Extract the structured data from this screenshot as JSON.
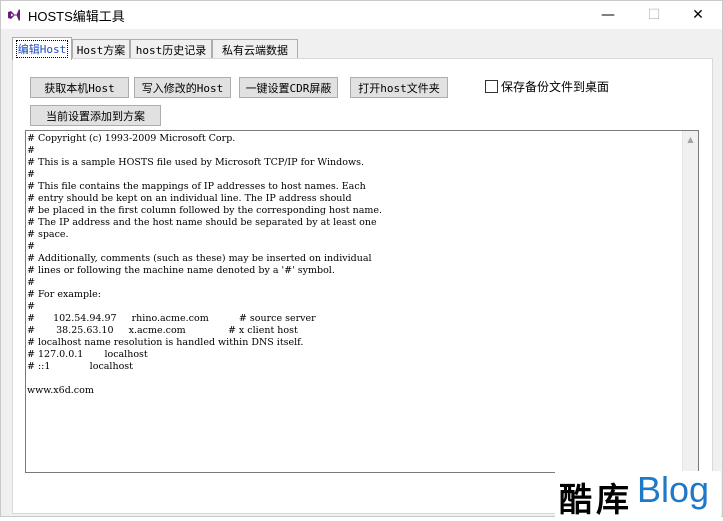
{
  "window": {
    "title": "HOSTS编辑工具",
    "minimize_glyph": "—",
    "maximize_glyph": "☐",
    "close_glyph": "✕"
  },
  "tabs": [
    {
      "label": "编辑Host",
      "active": true
    },
    {
      "label": "Host方案",
      "active": false
    },
    {
      "label": "host历史记录",
      "active": false
    },
    {
      "label": "私有云端数据",
      "active": false
    }
  ],
  "toolbar": {
    "get_local_host": "获取本机Host",
    "write_changes_host": "写入修改的Host",
    "one_click_cdr_block": "一键设置CDR屏蔽",
    "open_host_folder": "打开host文件夹",
    "add_current_to_plan": "当前设置添加到方案",
    "backup_checkbox_label": "保存备份文件到桌面",
    "backup_checked": false
  },
  "editor": {
    "content": "# Copyright (c) 1993-2009 Microsoft Corp.\n#\n# This is a sample HOSTS file used by Microsoft TCP/IP for Windows.\n#\n# This file contains the mappings of IP addresses to host names. Each\n# entry should be kept on an individual line. The IP address should\n# be placed in the first column followed by the corresponding host name.\n# The IP address and the host name should be separated by at least one\n# space.\n#\n# Additionally, comments (such as these) may be inserted on individual\n# lines or following the machine name denoted by a '#' symbol.\n#\n# For example:\n#\n#      102.54.94.97     rhino.acme.com          # source server\n#       38.25.63.10     x.acme.com              # x client host\n# localhost name resolution is handled within DNS itself.\n# 127.0.0.1       localhost\n# ::1             localhost\n\nwww.x6d.com"
  },
  "watermark": {
    "cn": "酷库",
    "en": "Blog"
  },
  "colors": {
    "accent": "#1c4fbf",
    "watermark_blue": "#1f78c8",
    "app_icon": "#68217a"
  },
  "icons": {
    "app": "visual-studio-icon",
    "scroll_up": "chevron-up-icon"
  }
}
